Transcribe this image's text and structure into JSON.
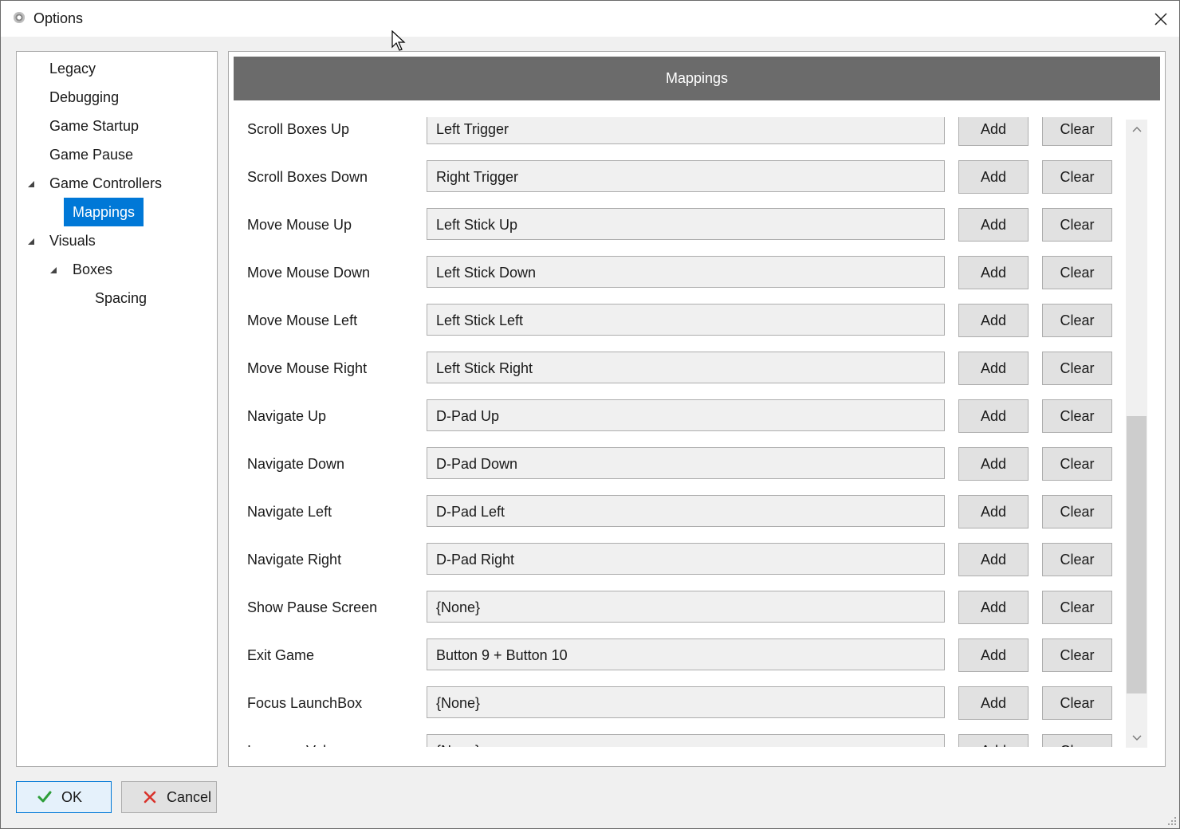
{
  "window": {
    "title": "Options",
    "close_icon": "close-icon"
  },
  "tree": [
    {
      "label": "Legacy"
    },
    {
      "label": "Debugging"
    },
    {
      "label": "Game Startup"
    },
    {
      "label": "Game Pause"
    },
    {
      "label": "Game Controllers",
      "expanded": true
    },
    {
      "label": "Mappings",
      "selected": true
    },
    {
      "label": "Visuals",
      "expanded": true
    },
    {
      "label": "Boxes",
      "expanded": true
    },
    {
      "label": "Spacing"
    }
  ],
  "section_header": "Mappings",
  "mappings": [
    {
      "action": "Scroll Boxes Up",
      "value": "Left Trigger"
    },
    {
      "action": "Scroll Boxes Down",
      "value": "Right Trigger"
    },
    {
      "action": "Move Mouse Up",
      "value": "Left Stick Up"
    },
    {
      "action": "Move Mouse Down",
      "value": "Left Stick Down"
    },
    {
      "action": "Move Mouse Left",
      "value": "Left Stick Left"
    },
    {
      "action": "Move Mouse Right",
      "value": "Left Stick Right"
    },
    {
      "action": "Navigate Up",
      "value": "D-Pad Up"
    },
    {
      "action": "Navigate Down",
      "value": "D-Pad Down"
    },
    {
      "action": "Navigate Left",
      "value": "D-Pad Left"
    },
    {
      "action": "Navigate Right",
      "value": "D-Pad Right"
    },
    {
      "action": "Show Pause Screen",
      "value": "{None}"
    },
    {
      "action": "Exit Game",
      "value": "Button 9 + Button 10"
    },
    {
      "action": "Focus LaunchBox",
      "value": "{None}"
    },
    {
      "action": "Increase Volume",
      "value": "{None}"
    }
  ],
  "row_buttons": {
    "add": "Add",
    "clear": "Clear"
  },
  "footer": {
    "ok": "OK",
    "cancel": "Cancel"
  },
  "colors": {
    "selection": "#0078d7",
    "header": "#6b6b6b",
    "ok_check": "#2e9e3a",
    "cancel_x": "#d9322b"
  }
}
